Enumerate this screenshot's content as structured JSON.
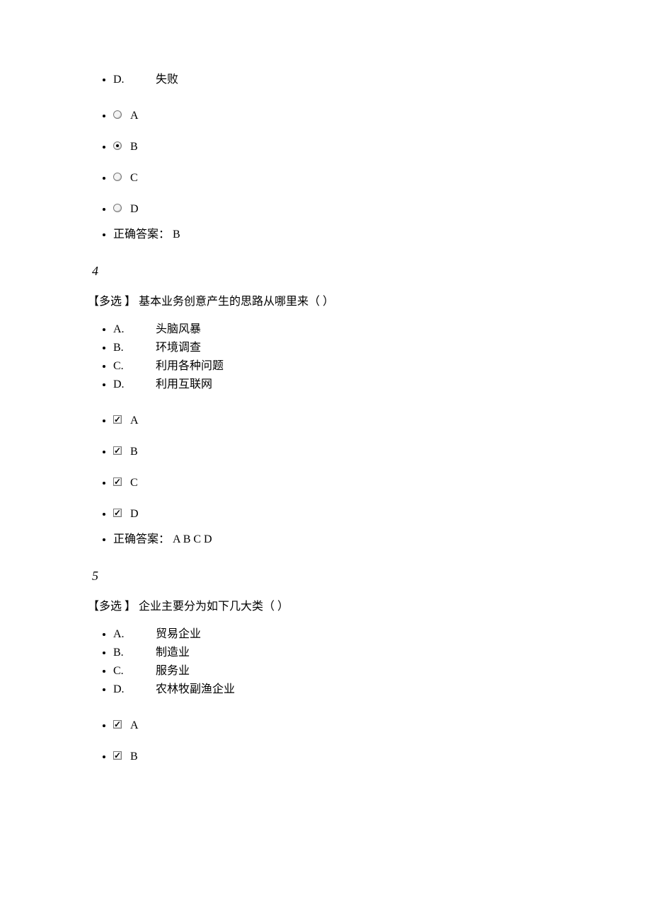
{
  "q3": {
    "options": {
      "D": {
        "letter": "D.",
        "text": "失败"
      }
    },
    "radios": {
      "A": {
        "label": "A",
        "checked": false
      },
      "B": {
        "label": "B",
        "checked": true
      },
      "C": {
        "label": "C",
        "checked": false
      },
      "D": {
        "label": "D",
        "checked": false
      }
    },
    "answer_label": "正确答案：",
    "answer_value": "B"
  },
  "q4": {
    "number": "4",
    "stem": "【多选 】 基本业务创意产生的思路从哪里来（ ）",
    "options": {
      "A": {
        "letter": "A.",
        "text": "头脑风暴"
      },
      "B": {
        "letter": "B.",
        "text": "环境调查"
      },
      "C": {
        "letter": "C.",
        "text": "利用各种问题"
      },
      "D": {
        "letter": "D.",
        "text": "利用互联网"
      }
    },
    "checks": {
      "A": {
        "label": "A",
        "checked": true
      },
      "B": {
        "label": "B",
        "checked": true
      },
      "C": {
        "label": "C",
        "checked": true
      },
      "D": {
        "label": "D",
        "checked": true
      }
    },
    "answer_label": "正确答案：",
    "answer_value": "A B C D"
  },
  "q5": {
    "number": "5",
    "stem": "【多选 】 企业主要分为如下几大类（ ）",
    "options": {
      "A": {
        "letter": "A.",
        "text": "贸易企业"
      },
      "B": {
        "letter": "B.",
        "text": "制造业"
      },
      "C": {
        "letter": "C.",
        "text": "服务业"
      },
      "D": {
        "letter": "D.",
        "text": "农林牧副渔企业"
      }
    },
    "checks": {
      "A": {
        "label": "A",
        "checked": true
      },
      "B": {
        "label": "B",
        "checked": true
      }
    }
  }
}
